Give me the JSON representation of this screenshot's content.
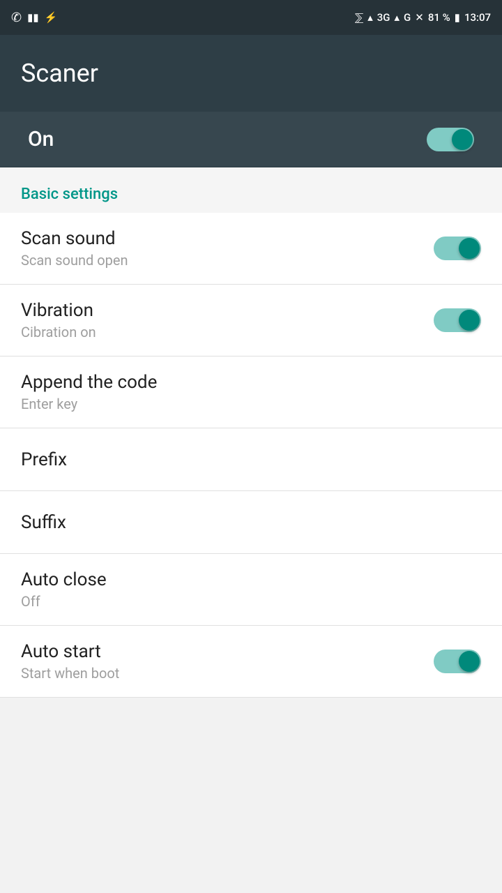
{
  "status_bar": {
    "time": "13:07",
    "battery": "81 %",
    "network": "3G",
    "network2": "G"
  },
  "app_bar": {
    "title": "Scaner"
  },
  "main_toggle": {
    "label": "On",
    "enabled": true
  },
  "section": {
    "title": "Basic settings"
  },
  "settings": [
    {
      "id": "scan-sound",
      "name": "Scan sound",
      "desc": "Scan sound open",
      "has_toggle": true,
      "toggle_on": true
    },
    {
      "id": "vibration",
      "name": "Vibration",
      "desc": "Cibration on",
      "has_toggle": true,
      "toggle_on": true
    },
    {
      "id": "append-code",
      "name": "Append the code",
      "desc": "Enter key",
      "has_toggle": false
    },
    {
      "id": "prefix",
      "name": "Prefix",
      "desc": "",
      "has_toggle": false
    },
    {
      "id": "suffix",
      "name": "Suffix",
      "desc": "",
      "has_toggle": false
    },
    {
      "id": "auto-close",
      "name": "Auto close",
      "desc": "Off",
      "has_toggle": false
    },
    {
      "id": "auto-start",
      "name": "Auto start",
      "desc": "Start when boot",
      "has_toggle": true,
      "toggle_on": true
    }
  ]
}
